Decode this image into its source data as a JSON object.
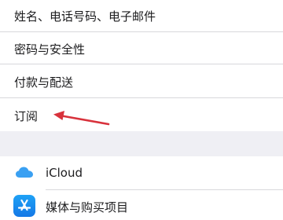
{
  "settings": {
    "rows": [
      {
        "label": "姓名、电话号码、电子邮件"
      },
      {
        "label": "密码与安全性"
      },
      {
        "label": "付款与配送"
      },
      {
        "label": "订阅"
      }
    ],
    "services": [
      {
        "label": "iCloud",
        "icon": "icloud-icon"
      },
      {
        "label": "媒体与购买项目",
        "icon": "app-store-icon"
      }
    ]
  },
  "annotation": {
    "arrow_color": "#d8323c",
    "target": "订阅"
  }
}
